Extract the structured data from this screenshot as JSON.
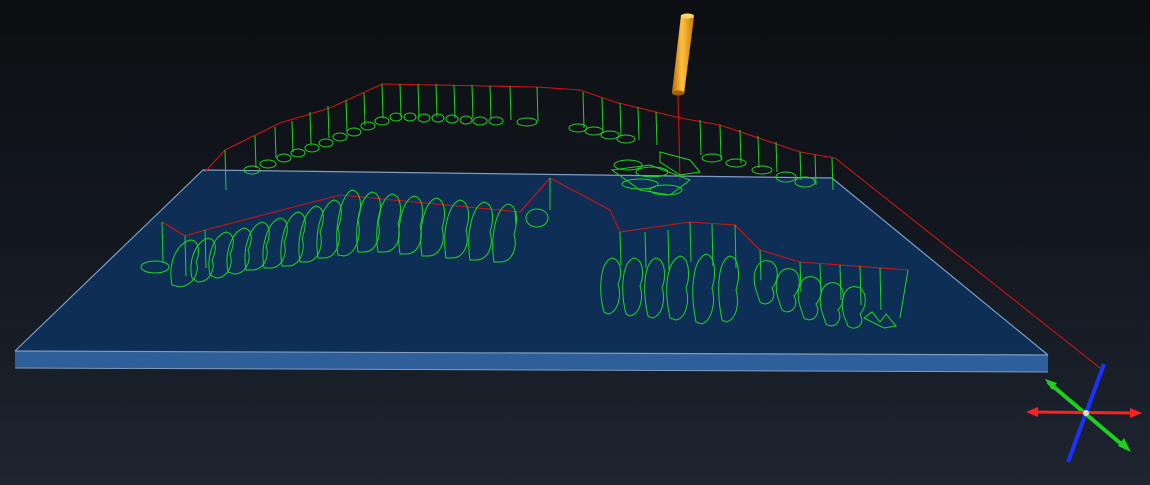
{
  "viewport": {
    "background_top": "#0c0e11",
    "background_bottom": "#1e2530"
  },
  "stock": {
    "top_color": "#0f3057",
    "edge_color": "#2e5f9a",
    "outline_color": "#7f9cc0"
  },
  "toolpath": {
    "cut_color": "#1fd51f",
    "rapid_color": "#cc1414"
  },
  "tool": {
    "icon": "end-mill-tool-icon",
    "color": "#ffa20a"
  },
  "axis_triad": {
    "icon": "xyz-axis-triad-icon",
    "x_color": "#ff2020",
    "y_color": "#1ecf1e",
    "z_color": "#1a32ff"
  }
}
